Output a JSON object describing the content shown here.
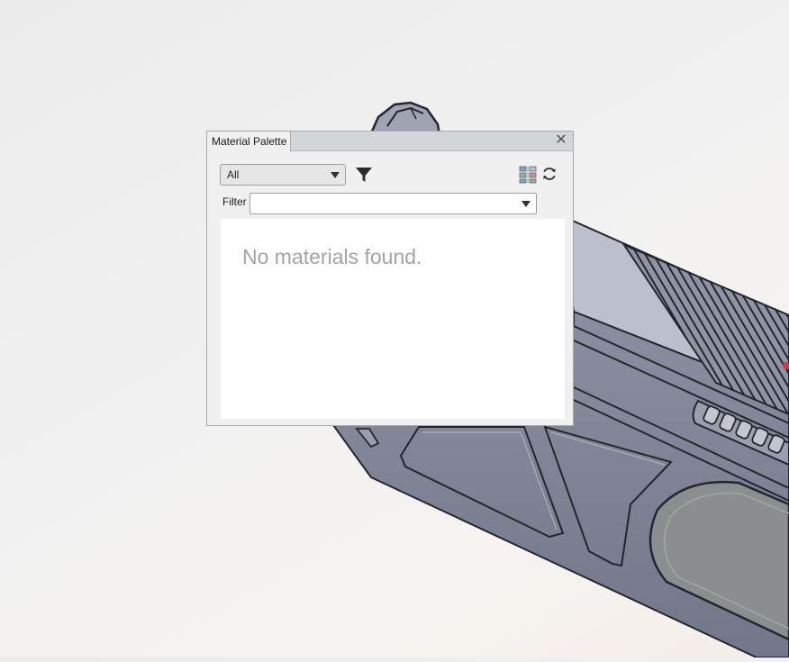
{
  "panel": {
    "title": "Material Palette",
    "close_glyph": "✕",
    "category_select": {
      "selected": "All"
    },
    "filter": {
      "label": "Filter",
      "value": ""
    },
    "empty_message": "No materials found."
  },
  "icons": {
    "close": "close-icon",
    "filter": "funnel-icon",
    "tree_view": "tree-view-icon",
    "refresh": "refresh-icon",
    "dropdown": "chevron-down-icon"
  },
  "colors": {
    "model_body": "#7d8293",
    "model_top": "#b9bdca",
    "model_edge": "#24262d",
    "accent_red": "#d23a4a",
    "panel_bg": "#f0f0f0",
    "titlebar_bg": "#d3d6d8"
  }
}
